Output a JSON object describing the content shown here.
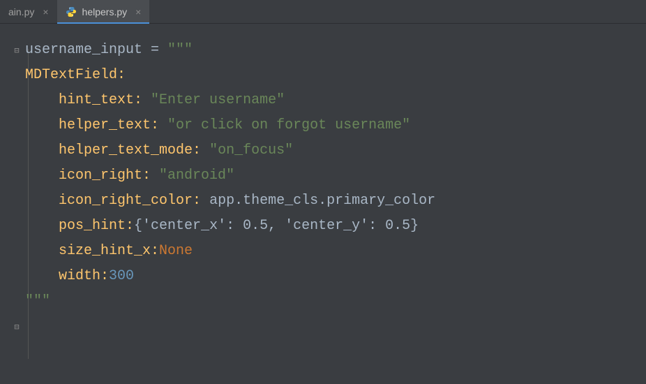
{
  "tabs": [
    {
      "label": "ain.py",
      "active": false
    },
    {
      "label": "helpers.py",
      "active": true
    }
  ],
  "code": {
    "line1_var": "username_input",
    "line1_op": " = ",
    "line1_str": "\"\"\"",
    "line2_class": "MDTextField:",
    "line3_prop": "hint_text: ",
    "line3_val": "\"Enter username\"",
    "line4_prop": "helper_text: ",
    "line4_val": "\"or click on forgot username\"",
    "line5_prop": "helper_text_mode: ",
    "line5_val": "\"on_focus\"",
    "line6_prop": "icon_right: ",
    "line6_val": "\"android\"",
    "line7_prop": "icon_right_color: ",
    "line7_val": "app.theme_cls.primary_color",
    "line8_prop": "pos_hint:",
    "line8_val": "{'center_x': 0.5, 'center_y': 0.5}",
    "line9_prop": "size_hint_x:",
    "line9_val": "None",
    "line10_prop": "width:",
    "line10_val": "300",
    "line11_str": "\"\"\""
  }
}
